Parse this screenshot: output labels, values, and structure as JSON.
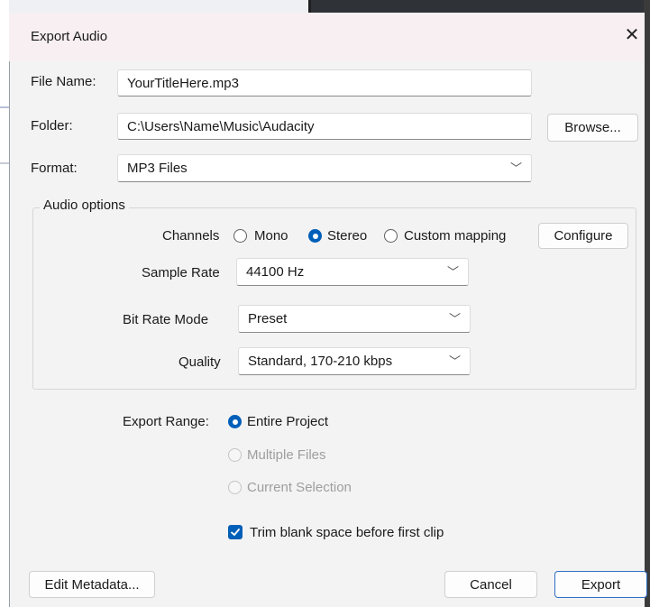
{
  "dialog": {
    "title": "Export Audio",
    "close_icon": "close-icon"
  },
  "file_name": {
    "label": "File Name:",
    "value": "YourTitleHere.mp3"
  },
  "folder": {
    "label": "Folder:",
    "value": "C:\\Users\\Name\\Music\\Audacity",
    "browse_label": "Browse..."
  },
  "format": {
    "label": "Format:",
    "value": "MP3 Files"
  },
  "audio_options": {
    "legend": "Audio options",
    "channels": {
      "label": "Channels",
      "options": [
        "Mono",
        "Stereo",
        "Custom mapping"
      ],
      "selected": "Stereo",
      "configure_label": "Configure"
    },
    "sample_rate": {
      "label": "Sample Rate",
      "value": "44100 Hz"
    },
    "bit_rate_mode": {
      "label": "Bit Rate Mode",
      "value": "Preset"
    },
    "quality": {
      "label": "Quality",
      "value": "Standard, 170-210 kbps"
    }
  },
  "export_range": {
    "label": "Export Range:",
    "options": [
      "Entire Project",
      "Multiple Files",
      "Current Selection"
    ],
    "selected": "Entire Project",
    "disabled": [
      "Multiple Files",
      "Current Selection"
    ]
  },
  "trim": {
    "label": "Trim blank space before first clip",
    "checked": true
  },
  "footer": {
    "edit_metadata_label": "Edit Metadata...",
    "cancel_label": "Cancel",
    "export_label": "Export"
  },
  "colors": {
    "accent": "#005fb8",
    "titlebar": "#f7eff2",
    "dialog_bg": "#f3f3f3"
  }
}
